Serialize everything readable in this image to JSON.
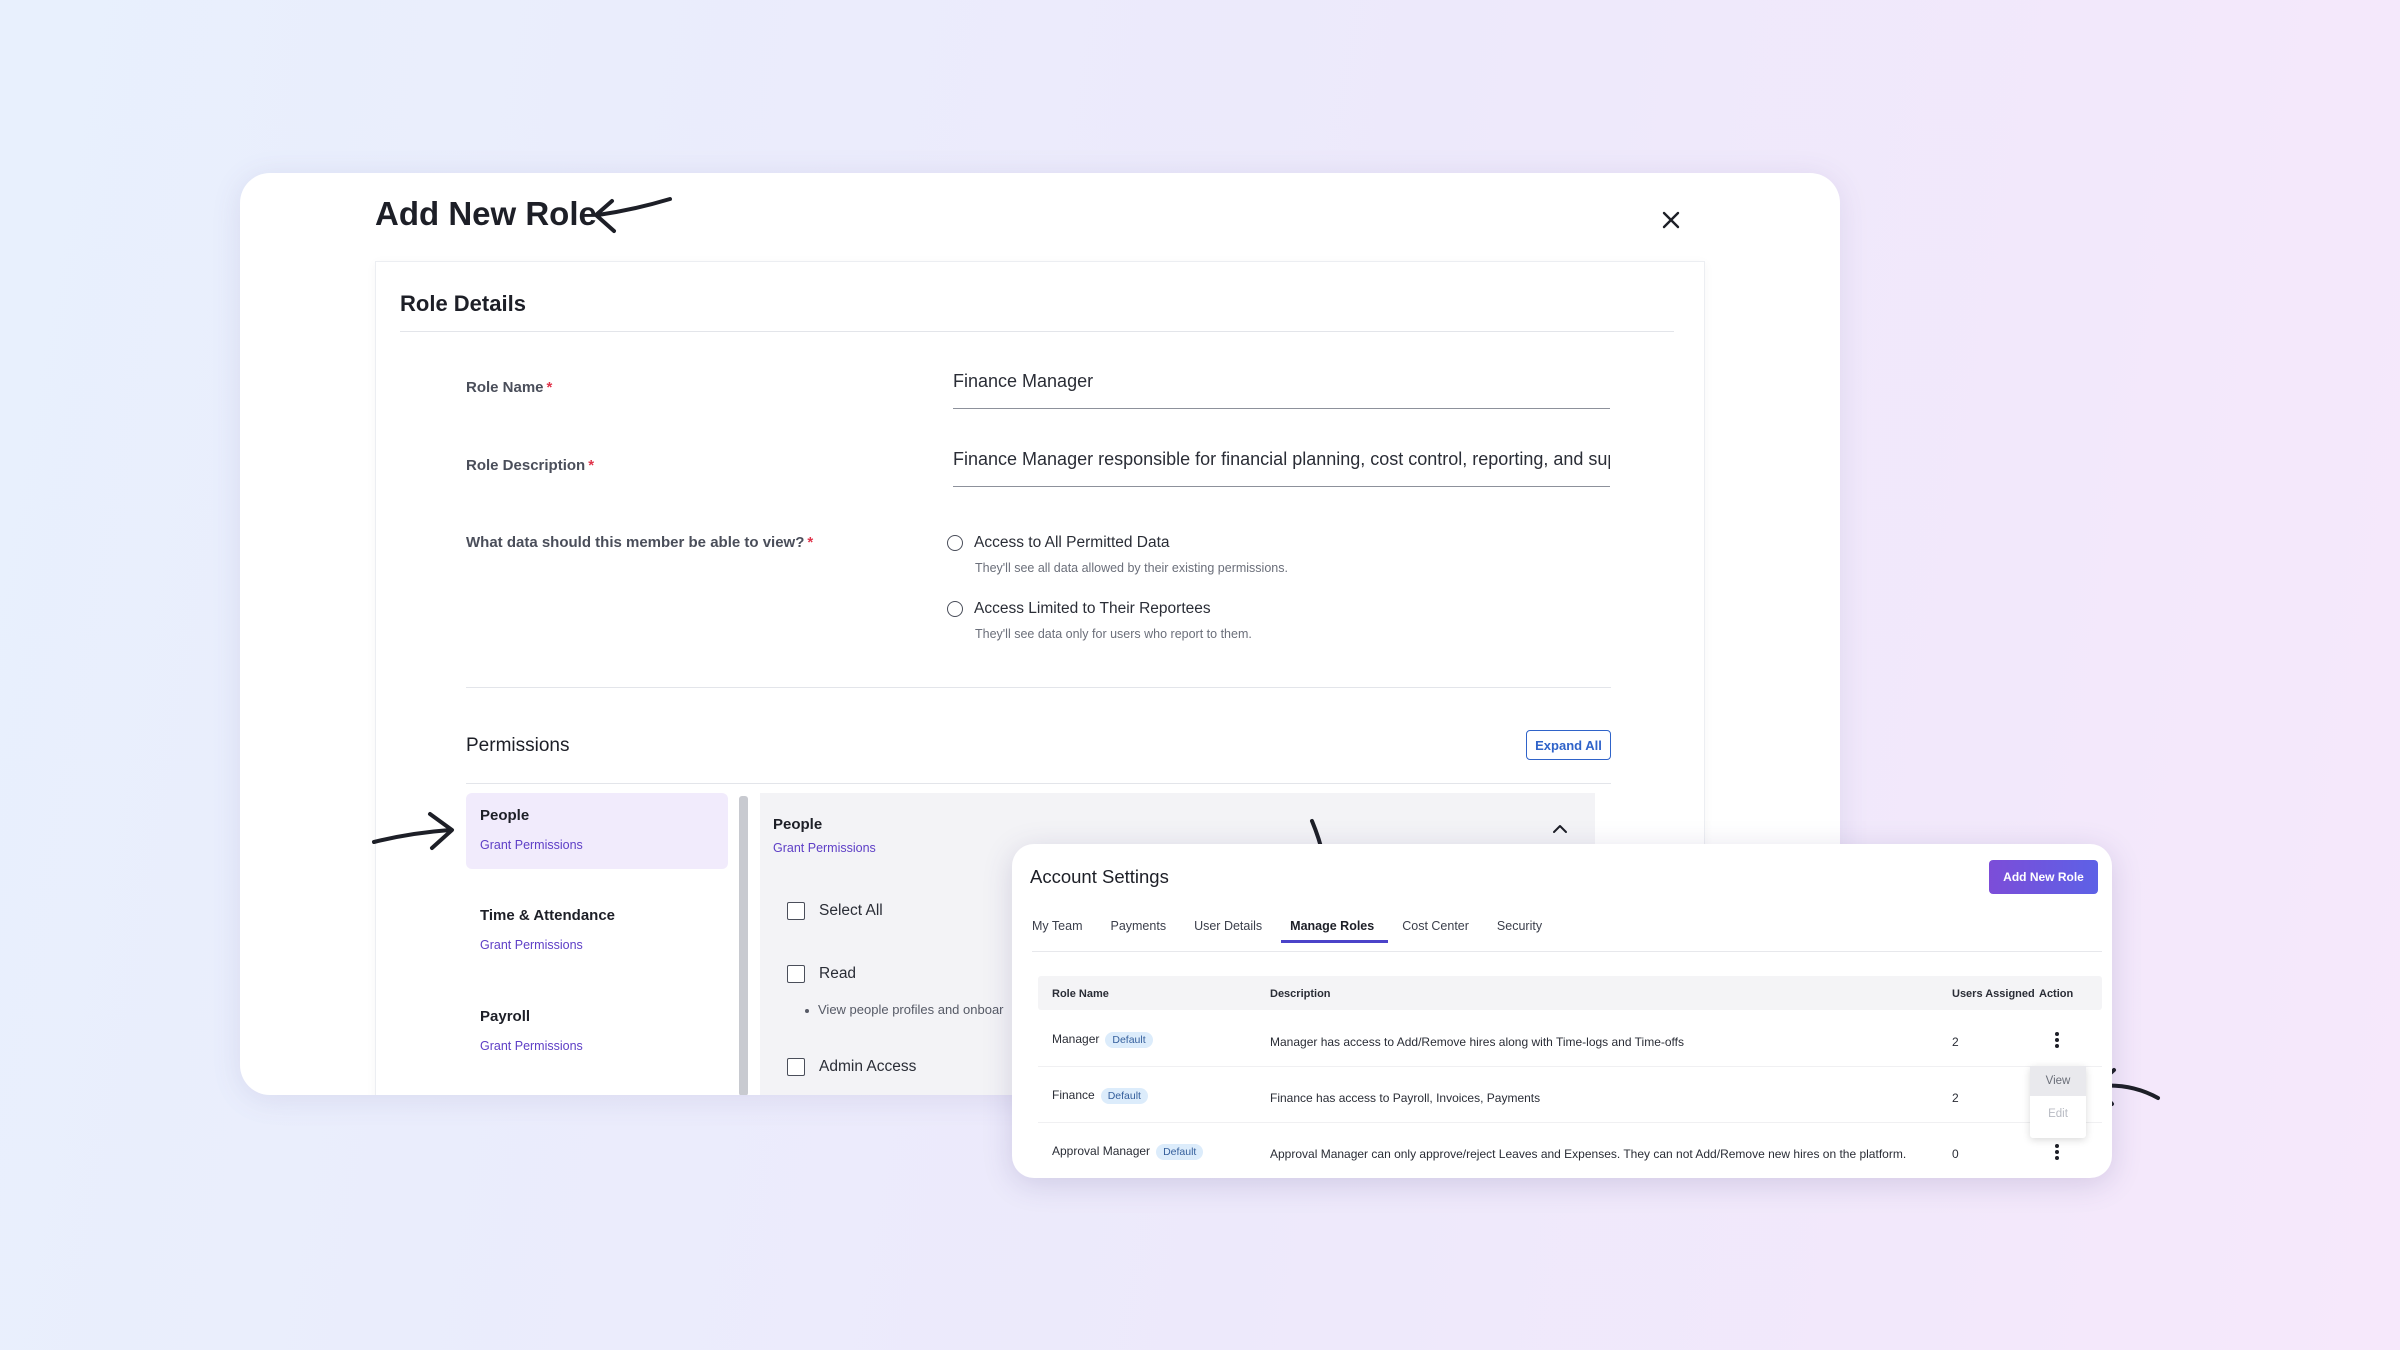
{
  "modal": {
    "title": "Add New Role",
    "section_title": "Role Details",
    "fields": {
      "role_name_label": "Role Name",
      "role_name_value": "Finance Manager",
      "role_description_label": "Role Description",
      "role_description_value": "Finance Manager responsible for financial planning, cost control, reporting, and sup",
      "data_view_label": "What data should this member be able to view?",
      "required_mark": "*"
    },
    "data_options": [
      {
        "label": "Access to All Permitted Data",
        "help": "They'll see all data allowed by their existing permissions."
      },
      {
        "label": "Access Limited to Their Reportees",
        "help": "They'll see data only for users who report to them."
      }
    ],
    "permissions": {
      "title": "Permissions",
      "expand_all": "Expand All",
      "categories": [
        {
          "name": "People",
          "link": "Grant Permissions"
        },
        {
          "name": "Time & Attendance",
          "link": "Grant Permissions"
        },
        {
          "name": "Payroll",
          "link": "Grant Permissions"
        }
      ],
      "detail": {
        "title": "People",
        "link": "Grant Permissions",
        "options": [
          "Select All",
          "Read",
          "Admin Access"
        ],
        "read_help": "View people profiles and onboar"
      }
    }
  },
  "account_settings": {
    "title": "Account Settings",
    "add_new_role": "Add New Role",
    "tabs": [
      "My Team",
      "Payments",
      "User Details",
      "Manage Roles",
      "Cost Center",
      "Security"
    ],
    "active_tab": "Manage Roles",
    "columns": [
      "Role Name",
      "Description",
      "Users Assigned",
      "Action"
    ],
    "rows": [
      {
        "name": "Manager",
        "badge": "Default",
        "description": "Manager has access to Add/Remove hires along with Time-logs and Time-offs",
        "users": "2"
      },
      {
        "name": "Finance",
        "badge": "Default",
        "description": "Finance has access to Payroll, Invoices, Payments",
        "users": "2"
      },
      {
        "name": "Approval Manager",
        "badge": "Default",
        "description": "Approval Manager can only approve/reject Leaves and Expenses. They can not Add/Remove new hires on the platform.",
        "users": "0"
      }
    ],
    "action_menu": [
      "View",
      "Edit"
    ]
  },
  "colors": {
    "accent_purple": "#5d3ec6",
    "button_blue": "#2f63c9",
    "active_tab_underline": "#4b43c9",
    "required_red": "#e0344b"
  },
  "icons": [
    "close-icon",
    "chevron-up-icon",
    "kebab-icon",
    "arrow-icon"
  ]
}
